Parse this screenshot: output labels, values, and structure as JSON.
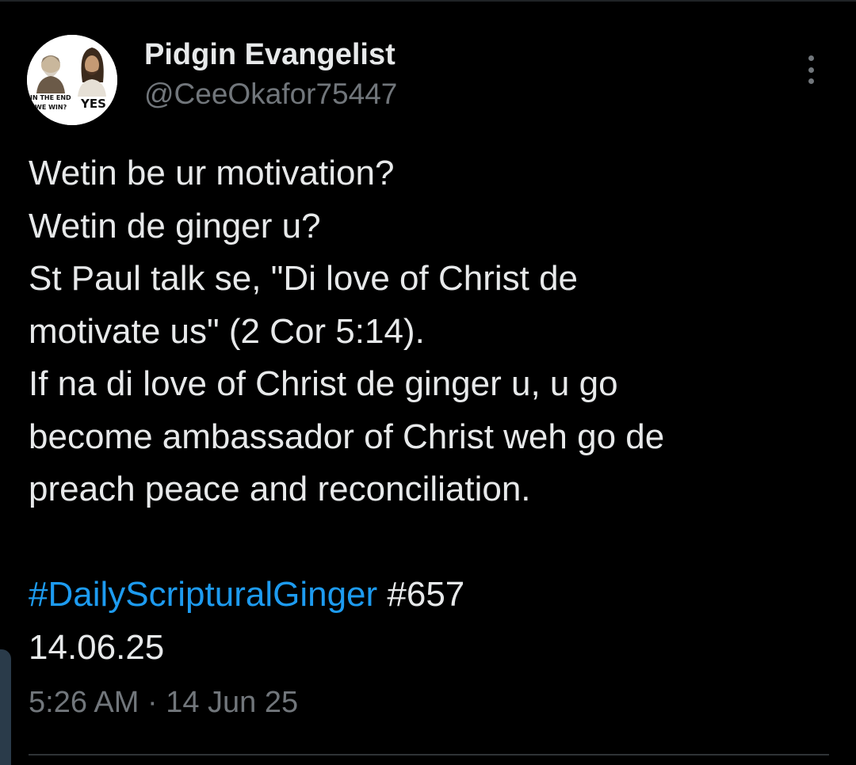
{
  "author": {
    "name": "Pidgin Evangelist",
    "handle": "@CeeOkafor75447",
    "avatar": {
      "text_left_1": "IN THE END",
      "text_left_2": "WE WIN?",
      "text_right": "YES"
    }
  },
  "tweet": {
    "lines": [
      "Wetin be ur motivation?",
      "Wetin de ginger u?",
      "St Paul talk se, \"Di love of Christ de",
      "motivate us\" (2 Cor 5:14).",
      "If na di love of Christ de ginger u, u go",
      "become ambassador of Christ weh go de",
      "preach peace and reconciliation."
    ],
    "hashtag": "#DailyScripturalGinger",
    "number": " #657",
    "date_line": "14.06.25"
  },
  "meta": {
    "time": "5:26 AM",
    "separator": " · ",
    "date": "14 Jun 25"
  },
  "icons": {
    "more": "more-vertical-icon"
  },
  "colors": {
    "background": "#000000",
    "primary_text": "#e7e9ea",
    "secondary_text": "#71767b",
    "link": "#1d9bf0"
  }
}
